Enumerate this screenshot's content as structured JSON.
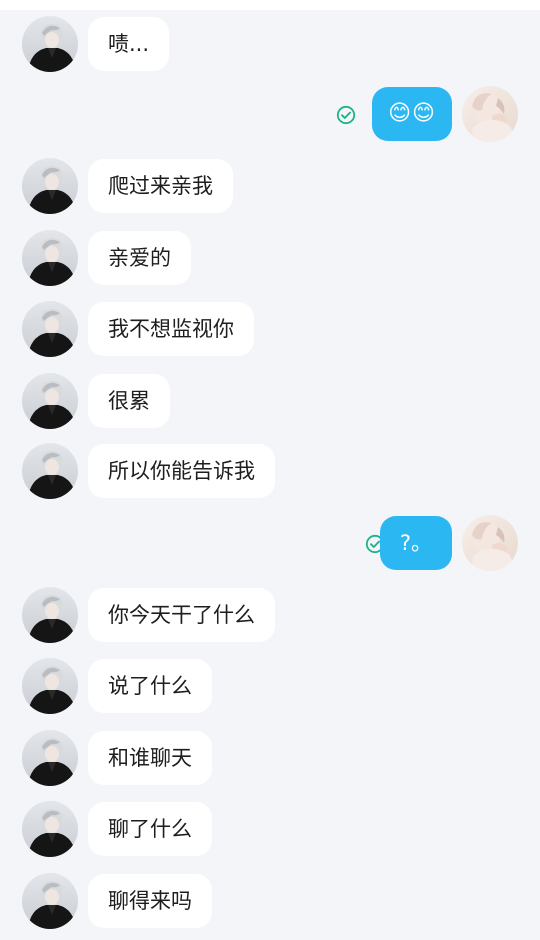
{
  "colors": {
    "background": "#f3f5f8",
    "incoming_bubble": "#ffffff",
    "outgoing_bubble": "#2ab7f2",
    "read_check": "#1db388"
  },
  "contact_avatar_icon": "contact-avatar-icon",
  "self_avatar_icon": "self-avatar-icon",
  "messages": [
    {
      "from": "contact",
      "text": "啧..."
    },
    {
      "from": "me",
      "text": "😊😊",
      "status": "read"
    },
    {
      "from": "contact",
      "text": "爬过来亲我"
    },
    {
      "from": "contact",
      "text": "亲爱的"
    },
    {
      "from": "contact",
      "text": "我不想监视你"
    },
    {
      "from": "contact",
      "text": "很累"
    },
    {
      "from": "contact",
      "text": "所以你能告诉我"
    },
    {
      "from": "me",
      "text": "?。",
      "status": "read"
    },
    {
      "from": "contact",
      "text": "你今天干了什么"
    },
    {
      "from": "contact",
      "text": "说了什么"
    },
    {
      "from": "contact",
      "text": "和谁聊天"
    },
    {
      "from": "contact",
      "text": "聊了什么"
    },
    {
      "from": "contact",
      "text": "聊得来吗"
    }
  ]
}
